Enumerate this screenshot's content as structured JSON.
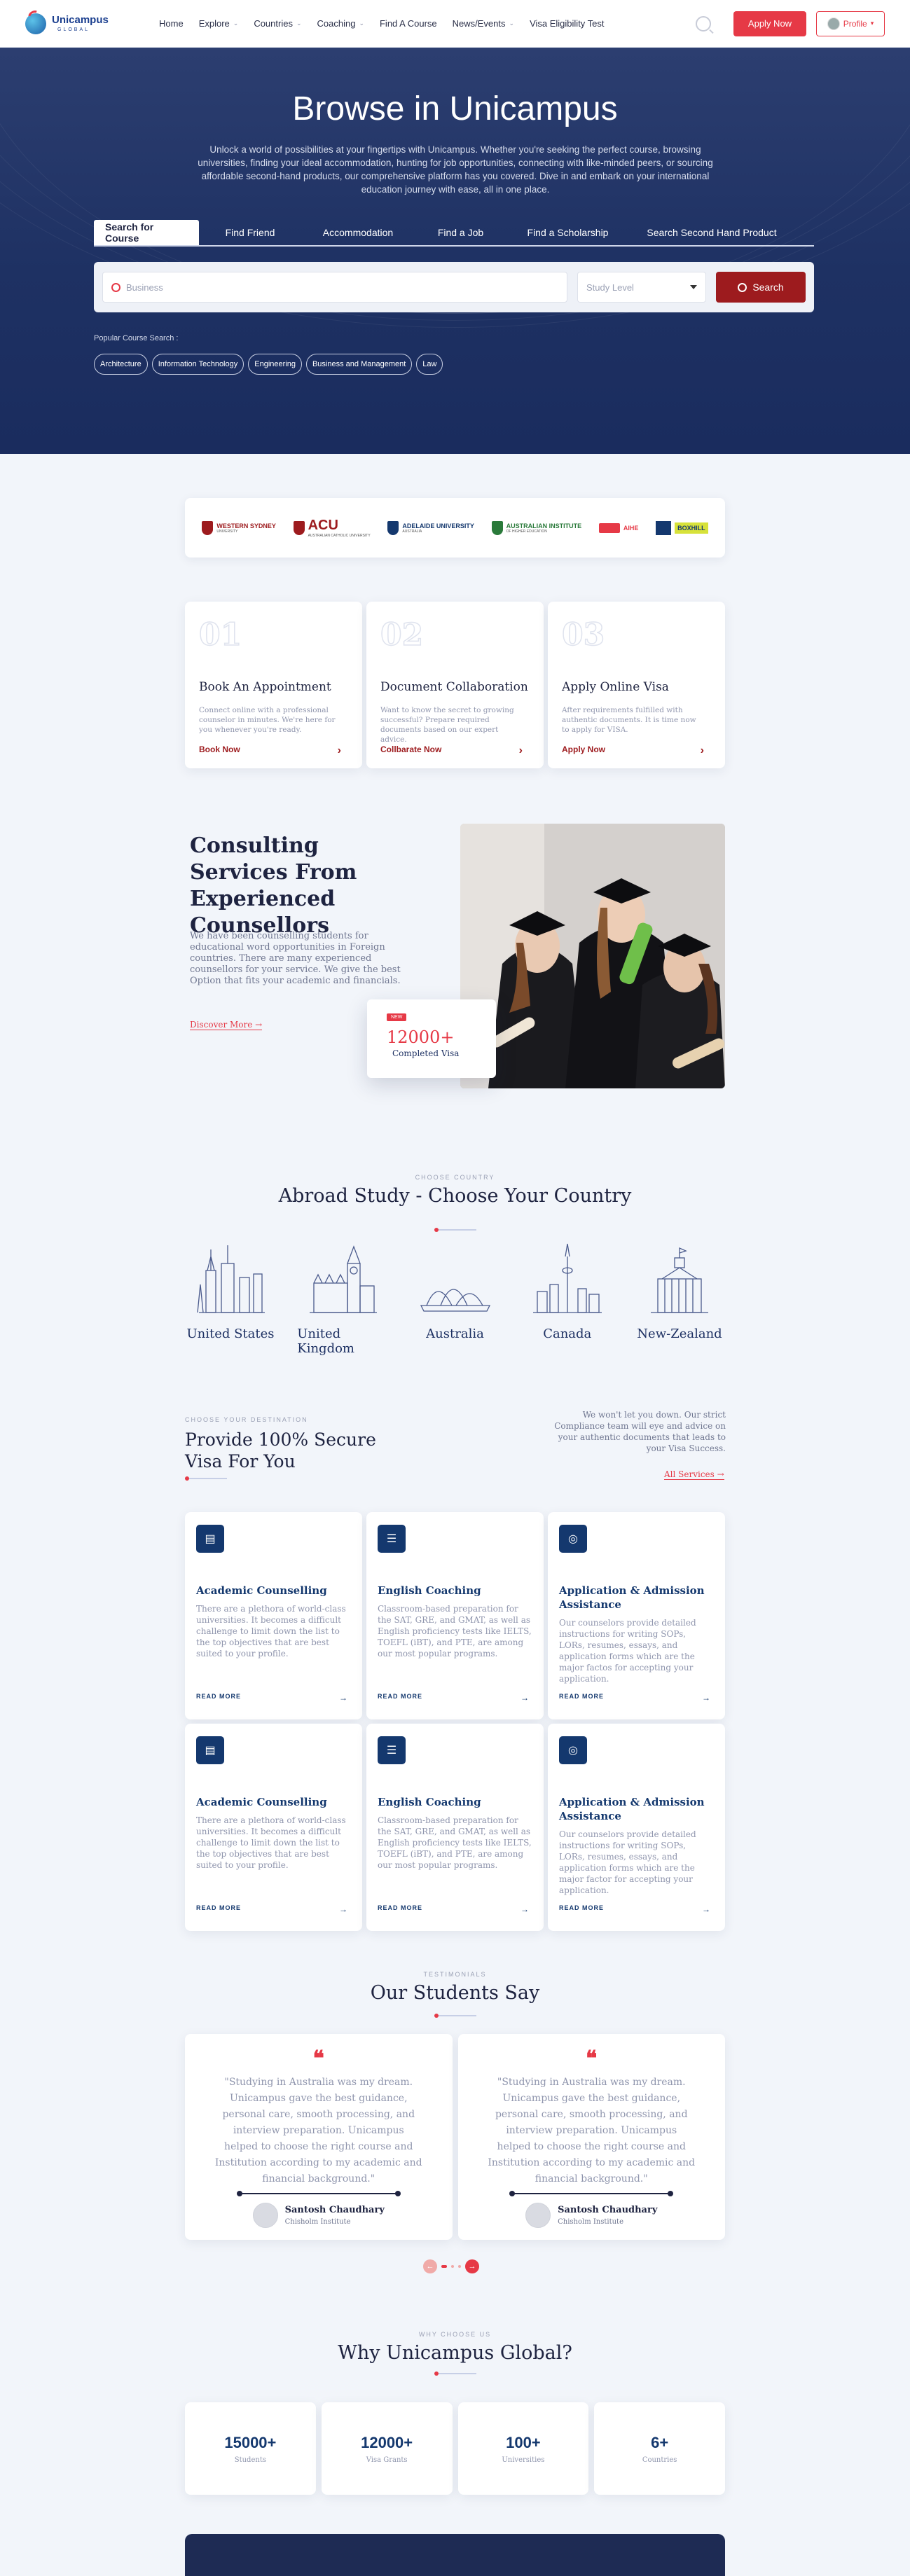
{
  "header": {
    "brand_name": "Unicampus",
    "brand_sub": "GLOBAL",
    "nav": [
      {
        "label": "Home",
        "dropdown": false
      },
      {
        "label": "Explore",
        "dropdown": true
      },
      {
        "label": "Countries",
        "dropdown": true
      },
      {
        "label": "Coaching",
        "dropdown": true
      },
      {
        "label": "Find A Course",
        "dropdown": false
      },
      {
        "label": "News/Events",
        "dropdown": true
      },
      {
        "label": "Visa Eligibility Test",
        "dropdown": false
      }
    ],
    "apply_label": "Apply Now",
    "profile_label": "Profile"
  },
  "hero": {
    "title": "Browse in Unicampus",
    "description": "Unlock a world of possibilities at your fingertips with Unicampus. Whether you're seeking the perfect course, browsing universities, finding your ideal accommodation, hunting for job opportunities, connecting with like-minded peers, or sourcing affordable second-hand products, our comprehensive platform has you covered. Dive in and embark on your international education journey with ease, all in one place.",
    "tabs": [
      "Search for Course",
      "Find Friend",
      "Accommodation",
      "Find a Job",
      "Find a Scholarship",
      "Search Second Hand Product"
    ],
    "active_tab": 0,
    "search_placeholder": "Business",
    "study_level_placeholder": "Study Level",
    "search_button": "Search",
    "popular_label": "Popular Course Search :",
    "popular": [
      "Architecture",
      "Information Technology",
      "Engineering",
      "Business and Management",
      "Law"
    ]
  },
  "partners": [
    {
      "name": "WESTERN SYDNEY",
      "sub": "UNIVERSITY",
      "color": "#9d1b1e"
    },
    {
      "name": "ACU",
      "sub": "AUSTRALIAN CATHOLIC UNIVERSITY",
      "color": "#9d1b1e"
    },
    {
      "name": "ADELAIDE UNIVERSITY",
      "sub": "AUSTRALIA",
      "color": "#14386e"
    },
    {
      "name": "AUSTRALIAN INSTITUTE",
      "sub": "OF HIGHER EDUCATION",
      "color": "#2a7a3a"
    },
    {
      "name": "AIHE",
      "sub": "",
      "color": "#e63946"
    },
    {
      "name": "BOXHILL",
      "sub": "",
      "color": "#14386e"
    }
  ],
  "steps": [
    {
      "num": "01",
      "title": "Book An Appointment",
      "desc": "Connect online with a professional counselor in minutes. We're here for you whenever you're ready.",
      "link": "Book Now"
    },
    {
      "num": "02",
      "title": "Document Collaboration",
      "desc": "Want to know the secret to growing successful? Prepare required documents based on our expert advice.",
      "link": "Collbarate Now"
    },
    {
      "num": "03",
      "title": "Apply Online Visa",
      "desc": "After requirements fulfilled with authentic documents. It is time now to apply for VISA.",
      "link": "Apply Now"
    }
  ],
  "consulting": {
    "title": "Consulting Services From Experienced Counsellors",
    "desc": "We have been counselling students for educational word opportunities in Foreign countries. There are many experienced counsellors for your service. We give the best Option that fits your academic and financials.",
    "link": "Discover More",
    "badge": "NEW",
    "stat_value": "12000+",
    "stat_label": "Completed Visa"
  },
  "countries_section": {
    "eyebrow": "CHOOSE COUNTRY",
    "title": "Abroad Study - Choose Your Country",
    "items": [
      "United States",
      "United Kingdom",
      "Australia",
      "Canada",
      "New-Zealand"
    ]
  },
  "visa_section": {
    "eyebrow": "CHOOSE YOUR DESTINATION",
    "title": "Provide 100% Secure Visa For You",
    "right_text": "We won't let you down. Our strict Compliance team will eye and advice on your authentic documents that leads to your Visa Success.",
    "all_link": "All Services",
    "read_more": "READ MORE",
    "cards": [
      {
        "title": "Academic Counselling",
        "desc": "There are a plethora of world-class universities. It becomes a difficult challenge to limit down the list to the top objectives that are best suited to your profile.",
        "icon": "document-icon"
      },
      {
        "title": "English Coaching",
        "desc": "Classroom-based preparation for the SAT, GRE, and GMAT, as well as English proficiency tests like IELTS, TOEFL (iBT), and PTE, are among our most popular programs.",
        "icon": "list-icon"
      },
      {
        "title": "Application & Admission Assistance",
        "desc": "Our counselors provide detailed instructions for writing SOPs, LORs, resumes, essays, and application forms which are the major factos for accepting your application.",
        "icon": "target-icon"
      },
      {
        "title": "Academic Counselling",
        "desc": "There are a plethora of world-class universities. It becomes a difficult challenge to limit down the list to the top objectives that are best suited to your profile.",
        "icon": "document-icon"
      },
      {
        "title": "English Coaching",
        "desc": "Classroom-based preparation for the SAT, GRE, and GMAT, as well as English proficiency tests like IELTS, TOEFL (iBT), and PTE, are among our most popular programs.",
        "icon": "list-icon"
      },
      {
        "title": "Application & Admission Assistance",
        "desc": "Our counselors provide detailed instructions for writing SOPs, LORs, resumes, essays, and application forms which are the major factor for accepting your application.",
        "icon": "target-icon"
      }
    ]
  },
  "testimonials": {
    "eyebrow": "TESTIMONIALS",
    "title": "Our Students Say",
    "items": [
      {
        "quote": "\"Studying in Australia was my dream. Unicampus gave the best guidance, personal care, smooth processing, and interview preparation. Unicampus helped to choose the right course and Institution according to my academic and financial background.\"",
        "name": "Santosh Chaudhary",
        "inst": "Chisholm Institute"
      },
      {
        "quote": "\"Studying in Australia was my dream. Unicampus gave the best guidance, personal care, smooth processing, and interview preparation. Unicampus helped to choose the right course and Institution according to my academic and financial background.\"",
        "name": "Santosh Chaudhary",
        "inst": "Chisholm Institute"
      }
    ]
  },
  "why": {
    "eyebrow": "WHY CHOOSE US",
    "title": "Why Unicampus Global?",
    "stats": [
      {
        "value": "15000+",
        "label": "Students"
      },
      {
        "value": "12000+",
        "label": "Visa Grants"
      },
      {
        "value": "100+",
        "label": "Universities"
      },
      {
        "value": "6+",
        "label": "Countries"
      }
    ]
  },
  "colors": {
    "accent": "#e63946",
    "navy": "#14386e",
    "hero": "#1e3163"
  }
}
